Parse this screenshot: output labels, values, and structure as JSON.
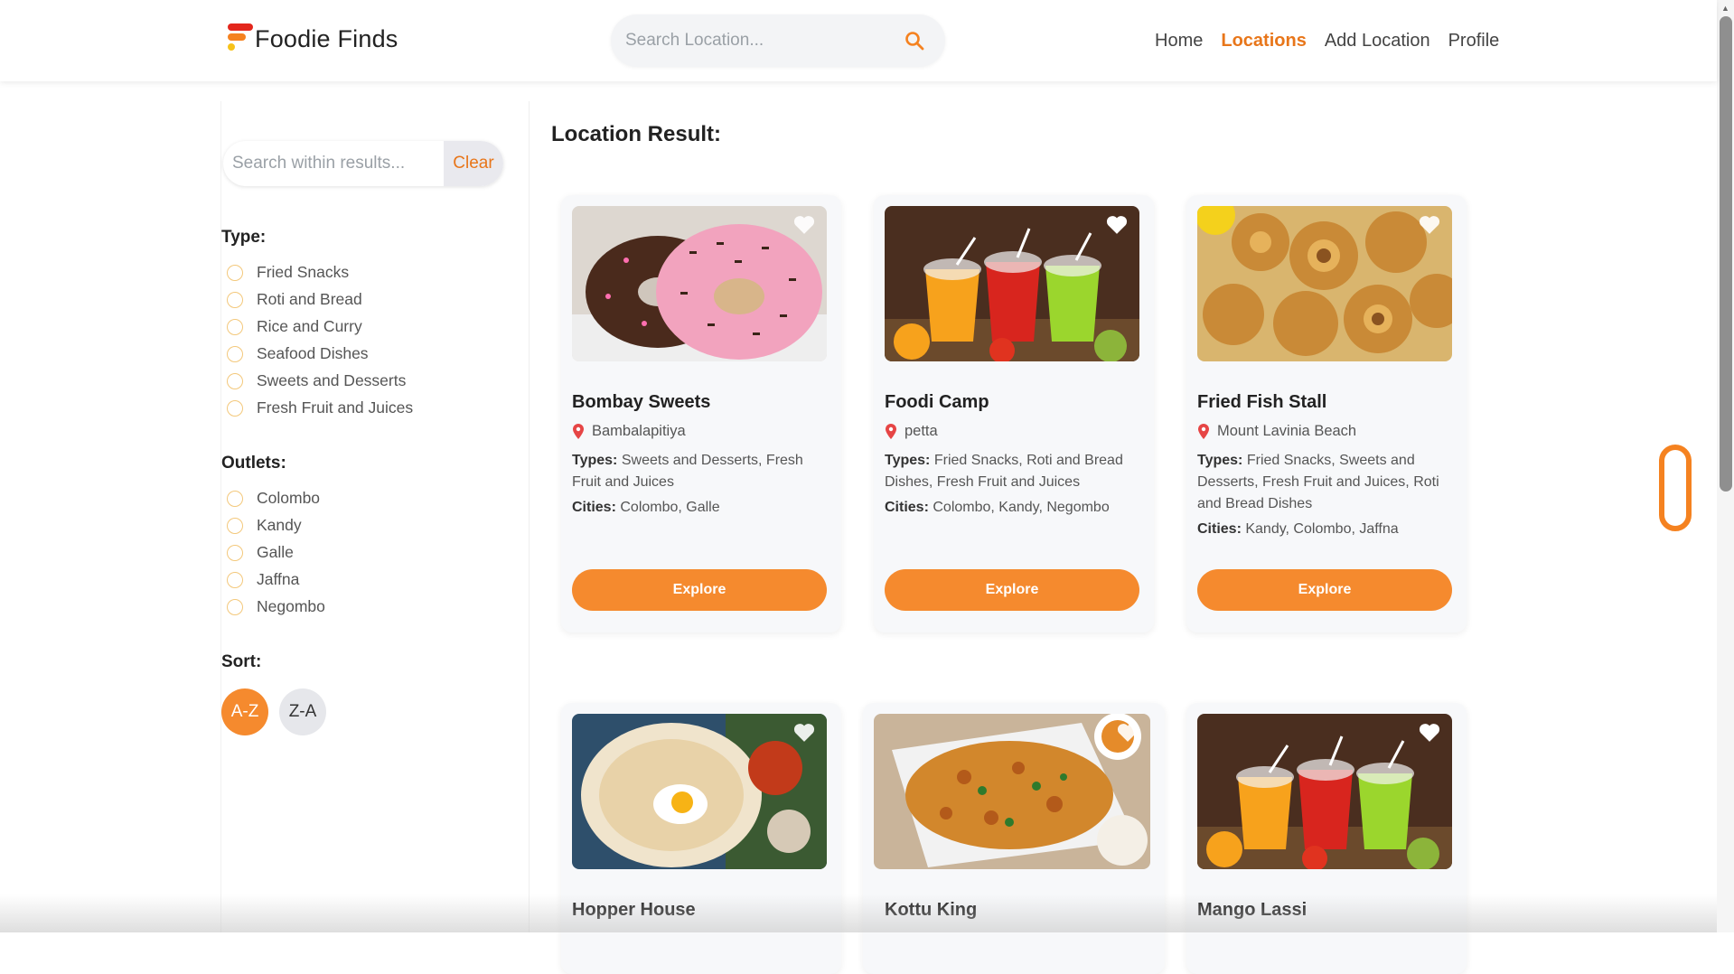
{
  "app": {
    "logo_text": "Foodie Finds"
  },
  "search": {
    "placeholder": "Search Location..."
  },
  "nav": {
    "items": [
      "Home",
      "Locations",
      "Add Location",
      "Profile"
    ],
    "active": "Locations"
  },
  "sidebar": {
    "search_placeholder": "Search within results...",
    "clear_label": "Clear",
    "type_title": "Type:",
    "types": [
      "Fried Snacks",
      "Roti and Bread",
      "Rice and Curry",
      "Seafood Dishes",
      "Sweets and Desserts",
      "Fresh Fruit and Juices"
    ],
    "outlets_title": "Outlets:",
    "outlets": [
      "Colombo",
      "Kandy",
      "Galle",
      "Jaffna",
      "Negombo"
    ],
    "sort_title": "Sort:",
    "sort_az": "A-Z",
    "sort_za": "Z-A"
  },
  "main": {
    "title": "Location Result:",
    "types_label": "Types:",
    "cities_label": "Cities:",
    "explore_label": "Explore",
    "cards": [
      {
        "name": "Bombay Sweets",
        "location": "Bambalapitiya",
        "types": "Sweets and Desserts, Fresh Fruit and Juices",
        "cities": "Colombo, Galle",
        "image": "donuts"
      },
      {
        "name": "Foodi Camp",
        "location": "petta",
        "types": "Fried Snacks, Roti and Bread Dishes, Fresh Fruit and Juices",
        "cities": "Colombo, Kandy, Negombo",
        "image": "juices"
      },
      {
        "name": "Fried Fish Stall",
        "location": "Mount Lavinia Beach",
        "types": "Fried Snacks, Sweets and Desserts, Fresh Fruit and Juices, Roti and Bread Dishes",
        "cities": "Kandy, Colombo, Jaffna",
        "image": "vadai"
      },
      {
        "name": "Hopper House",
        "image": "hopper"
      },
      {
        "name": "Kottu King",
        "image": "kottu"
      },
      {
        "name": "Mango Lassi",
        "image": "juices"
      }
    ]
  },
  "colors": {
    "accent": "#f58a2e",
    "active_nav": "#e8761a"
  }
}
